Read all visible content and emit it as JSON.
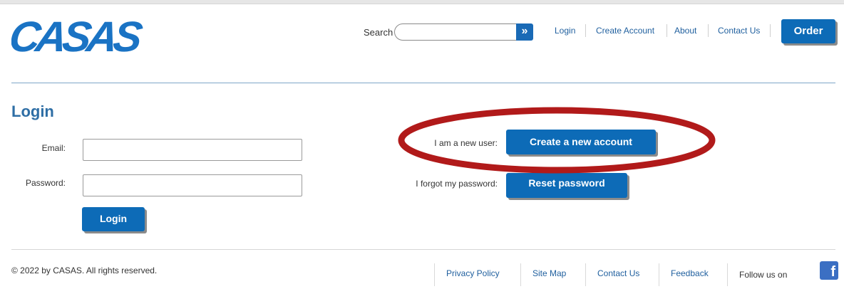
{
  "brand": {
    "logo_text": "CASAS",
    "color": "#1a73c4"
  },
  "header": {
    "search_label": "Search",
    "search_value": "",
    "search_button_glyph": "»",
    "nav": [
      "Login",
      "Create Account",
      "About",
      "Contact Us"
    ],
    "order_label": "Order"
  },
  "main": {
    "title": "Login",
    "email_label": "Email:",
    "email_value": "",
    "password_label": "Password:",
    "password_value": "",
    "login_label": "Login",
    "new_user_label": "I am a new user:",
    "create_account_label": "Create a new account",
    "forgot_label": "I forgot my password:",
    "reset_label": "Reset password"
  },
  "annotation": {
    "highlight_color": "#b11a1a"
  },
  "footer": {
    "copyright": "© 2022 by CASAS. All rights reserved.",
    "links": [
      "Privacy Policy",
      "Site Map",
      "Contact Us",
      "Feedback"
    ],
    "follow_text": "Follow us on",
    "social_icon": "facebook-icon",
    "social_glyph": "f"
  },
  "colors": {
    "accent": "#0d6bb7",
    "link": "#1f5f9e",
    "title": "#2e6ea5"
  }
}
